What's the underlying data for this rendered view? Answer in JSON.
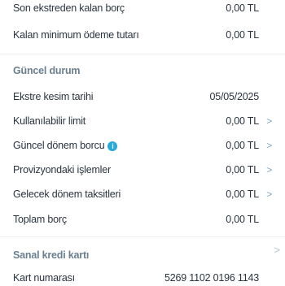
{
  "top_rows": [
    {
      "label": "Son ekstreden kalan borç",
      "value": "0,00 TL"
    },
    {
      "label": "Kalan minimum ödeme tutarı",
      "value": "0,00 TL"
    }
  ],
  "current_status": {
    "title": "Güncel durum",
    "rows": [
      {
        "label": "Ekstre kesim tarihi",
        "value": "05/05/2025",
        "chevron": false
      },
      {
        "label": "Kullanılabilir limit",
        "value": "0,00 TL",
        "chevron": true
      },
      {
        "label": "Güncel dönem borcu",
        "value": "0,00 TL",
        "chevron": true,
        "info": true
      },
      {
        "label": "Provizyondaki işlemler",
        "value": "0,00 TL",
        "chevron": true
      },
      {
        "label": "Gelecek dönem taksitleri",
        "value": "0,00 TL",
        "chevron": true
      },
      {
        "label": "Toplam borç",
        "value": "0,00 TL",
        "chevron": false
      }
    ]
  },
  "virtual_card": {
    "title": "Sanal kredi kartı",
    "rows": [
      {
        "label": "Kart numarası",
        "value": "5269 1102 0196 1143"
      }
    ]
  },
  "icons": {
    "chevron": "chevron-right-icon",
    "info": "info-icon"
  },
  "colors": {
    "chevron": "#7aa7c7",
    "info": "#27a9d9",
    "section_title": "#6a7f90"
  }
}
